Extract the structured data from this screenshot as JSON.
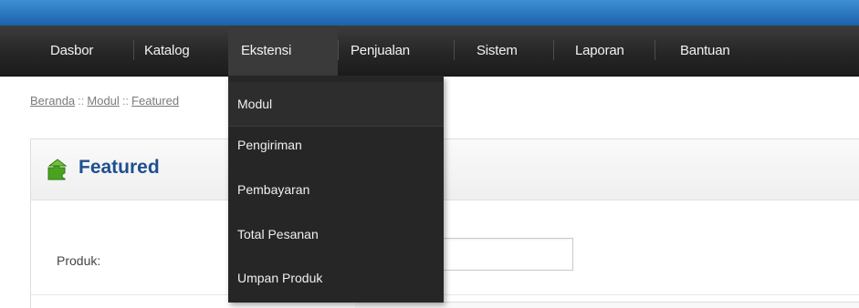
{
  "nav": {
    "items": [
      {
        "label": "Dasbor"
      },
      {
        "label": "Katalog"
      },
      {
        "label": "Ekstensi"
      },
      {
        "label": "Penjualan"
      },
      {
        "label": "Sistem"
      },
      {
        "label": "Laporan"
      },
      {
        "label": "Bantuan"
      }
    ],
    "active_index": 2
  },
  "breadcrumb": {
    "items": [
      "Beranda",
      "Modul",
      "Featured"
    ],
    "separator": "::"
  },
  "panel": {
    "title": "Featured",
    "icon": "puzzle-icon",
    "form": {
      "produk_label": "Produk:"
    }
  },
  "dropdown": {
    "items": [
      {
        "label": "Modul"
      },
      {
        "label": "Pengiriman"
      },
      {
        "label": "Pembayaran"
      },
      {
        "label": "Total Pesanan"
      },
      {
        "label": "Umpan Produk"
      }
    ]
  },
  "colors": {
    "top_band": "#1a62ab",
    "nav_bg": "#262626",
    "title": "#1e4f8f",
    "icon_green": "#4aa31f"
  }
}
